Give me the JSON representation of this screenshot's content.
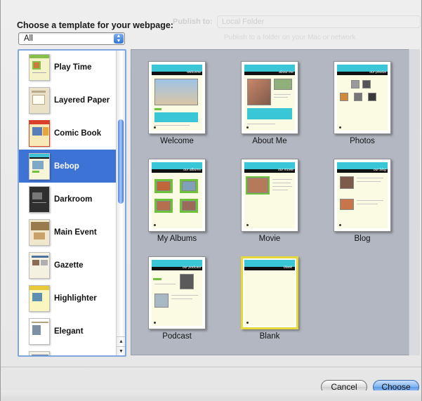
{
  "dialog": {
    "heading": "Choose a template for your webpage:",
    "filter_value": "All",
    "ghost_label": "Publish to:",
    "ghost_value": "Local Folder",
    "ghost_hint": "Publish to a folder on your Mac or network"
  },
  "themes": [
    {
      "label": "Play Time",
      "colors": [
        "#f4f3c8",
        "#86c04a"
      ]
    },
    {
      "label": "Layered Paper",
      "colors": [
        "#e9e1c8",
        "#b8a98a"
      ]
    },
    {
      "label": "Comic Book",
      "colors": [
        "#f8e9b8",
        "#d9402c"
      ]
    },
    {
      "label": "Bebop",
      "colors": [
        "#f7f6d8",
        "#3ec2d6"
      ]
    },
    {
      "label": "Darkroom",
      "colors": [
        "#2f2f2f",
        "#777777"
      ]
    },
    {
      "label": "Main Event",
      "colors": [
        "#f0e8cc",
        "#9a7b4d"
      ]
    },
    {
      "label": "Gazette",
      "colors": [
        "#f5f1e0",
        "#4c6f9e"
      ]
    },
    {
      "label": "Highlighter",
      "colors": [
        "#faf6c0",
        "#e7c93a"
      ]
    },
    {
      "label": "Elegant",
      "colors": [
        "#ffffff",
        "#b2a47c"
      ]
    }
  ],
  "selected_theme": "Bebop",
  "templates": [
    {
      "caption": "Welcome",
      "label": "welcome"
    },
    {
      "caption": "About Me",
      "label": "about me"
    },
    {
      "caption": "Photos",
      "label": "our photos"
    },
    {
      "caption": "My Albums",
      "label": "our albums"
    },
    {
      "caption": "Movie",
      "label": "our movie"
    },
    {
      "caption": "Blog",
      "label": "our blog"
    },
    {
      "caption": "Podcast",
      "label": "our podcast"
    },
    {
      "caption": "Blank",
      "label": "blank"
    }
  ],
  "buttons": {
    "cancel": "Cancel",
    "choose": "Choose"
  },
  "colors": {
    "accent": "#3d73d4",
    "grid_background": "#b3b7c1",
    "theme_cyan": "#39c6d6",
    "blank_border": "#e6d93a"
  },
  "icons": {
    "popup_arrows": "up-down-chevron-icon",
    "scroll_up": "scroll-up-arrow-icon",
    "scroll_down": "scroll-down-arrow-icon"
  }
}
